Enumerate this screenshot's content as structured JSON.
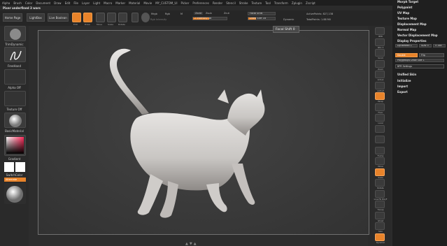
{
  "menu": [
    "Alpha",
    "Brush",
    "Color",
    "Document",
    "Draw",
    "Edit",
    "File",
    "Layer",
    "Light",
    "Macro",
    "Marker",
    "Material",
    "Movie",
    "MY_CUSTOM_UI",
    "Picker",
    "Preferences",
    "Render",
    "Stencil",
    "Stroke",
    "Texture",
    "Tool",
    "Transform",
    "Zplugin",
    "Zscript"
  ],
  "document_title": "Pixer underfined 3 wars",
  "shelf": {
    "home": "Home Page",
    "lightbox": "LightBox",
    "live_boolean": "Live Boolean",
    "edit": "Edit",
    "draw": "Draw",
    "move": "Move",
    "scale": "Scale",
    "rotate": "Rotate",
    "mrgb": "Mrgb",
    "rgb": "Rgb",
    "m": "M",
    "zadd": "Zadd",
    "zsub": "Zsub",
    "zcut": "Zcut",
    "rgb_intensity": "Rgb Intensity",
    "z_intensity": "Z Intensity 48",
    "focal_shift": "Focal Shift",
    "draw_size": "Draw Size 18",
    "dynamic": "Dynamic",
    "active_points": "ActivePoints: 827,138",
    "total_points": "TotalPoints: 1.88 Mil"
  },
  "tooltip": "Focal Shift 0",
  "left_tray": {
    "brush_label": "TrimDynamic",
    "stroke_label": "FreeHand",
    "alpha_label": "Alpha Off",
    "texture_label": "Texture Off",
    "material_label": "BasicMaterial",
    "gradient_label": "Gradient",
    "switch_label": "SwitchColor",
    "alternate_label": "Alternate"
  },
  "right_shelf": [
    "BPR",
    "SPix 3",
    "Scroll",
    "Zoom",
    "Actual",
    "AAHalf",
    "Persp",
    "Floor",
    "Local",
    "",
    "",
    "Frame",
    "Move",
    "Scale",
    "Rotate",
    "Line Fill PolyF",
    "Transp",
    "Ghost",
    "Solo",
    "Dynamic"
  ],
  "right_panel": {
    "items": [
      "Morph Target",
      "Polypaint",
      "UV Map",
      "Texture Map",
      "Displacement Map",
      "Normal Map",
      "Vector Displacement Map",
      "Display Properties"
    ],
    "dynamesh": "Dynamesh 1",
    "sdiv": "SDiv 3",
    "ss": "5 148",
    "double": "Double",
    "flip": "Flip",
    "polygroups": "Polygroups Draw Size 1",
    "bpr_settings": "BPR Settings",
    "lower_items": [
      "Unified Skin",
      "Initialize",
      "Import",
      "Export"
    ]
  },
  "colors": {
    "accent": "#e8832a",
    "background": "#2b2b2b",
    "canvas": "#3b3b3b"
  }
}
